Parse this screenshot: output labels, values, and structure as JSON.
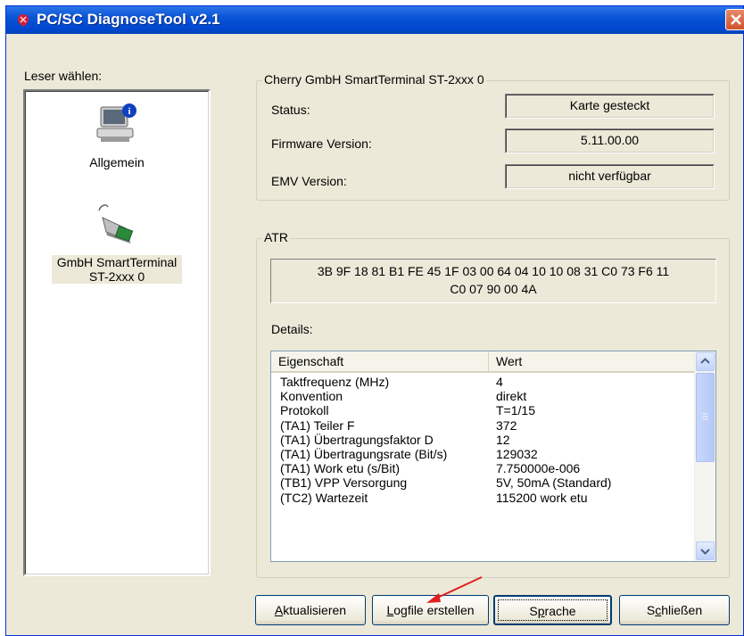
{
  "window": {
    "title": "PC/SC DiagnoseTool v2.1"
  },
  "reader_panel": {
    "label": "Leser wählen:",
    "items": [
      {
        "label": "Allgemein",
        "icon": "computer-info-icon"
      },
      {
        "label_line1": "GmbH SmartTerminal",
        "label_line2": "ST-2xxx 0",
        "icon": "card-reader-icon",
        "selected": true
      }
    ]
  },
  "device_group": {
    "title": "Cherry GmbH SmartTerminal ST-2xxx 0",
    "status_label": "Status:",
    "status_value": "Karte gesteckt",
    "firmware_label": "Firmware Version:",
    "firmware_value": "5.11.00.00",
    "emv_label": "EMV Version:",
    "emv_value": "nicht verfügbar"
  },
  "atr_group": {
    "title": "ATR",
    "atr_line1": "3B 9F 18 81 B1 FE 45 1F 03 00 64 04 10 10 08 31 C0 73 F6 11",
    "atr_line2": "C0 07 90 00 4A",
    "details_label": "Details:",
    "columns": [
      "Eigenschaft",
      "Wert"
    ],
    "rows": [
      {
        "prop": "Taktfrequenz (MHz)",
        "value": "4"
      },
      {
        "prop": "Konvention",
        "value": "direkt"
      },
      {
        "prop": "Protokoll",
        "value": "T=1/15"
      },
      {
        "prop": "(TA1) Teiler F",
        "value": "372"
      },
      {
        "prop": "(TA1) Übertragungsfaktor D",
        "value": "12"
      },
      {
        "prop": "(TA1) Übertragungsrate (Bit/s)",
        "value": "129032"
      },
      {
        "prop": "(TA1) Work etu (s/Bit)",
        "value": "7.750000e-006"
      },
      {
        "prop": "(TB1) VPP Versorgung",
        "value": "5V, 50mA (Standard)"
      },
      {
        "prop": "(TC2) Wartezeit",
        "value": "115200 work etu"
      }
    ]
  },
  "buttons": {
    "refresh_key": "A",
    "refresh_rest": "ktualisieren",
    "logfile_key": "L",
    "logfile_rest": "ogfile erstellen",
    "language_pre": "S",
    "language_key": "p",
    "language_rest": "rache",
    "close_pre": "S",
    "close_key": "c",
    "close_rest": "hließen"
  },
  "colors": {
    "titlebar": "#0a54d6",
    "window_bg": "#ece9d8",
    "annotation_arrow": "#e02020"
  }
}
